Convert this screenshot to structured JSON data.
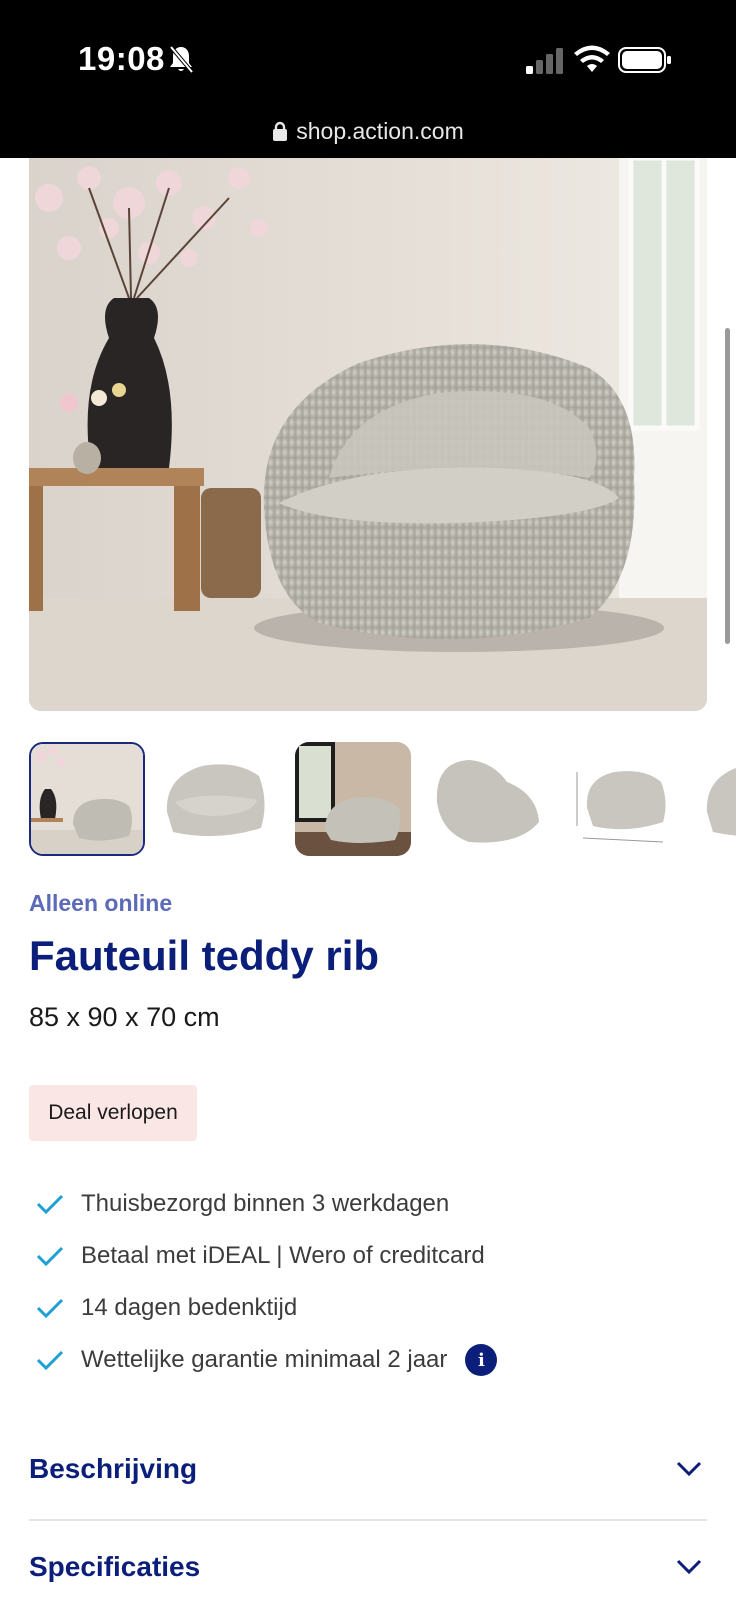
{
  "status_bar": {
    "time": "19:08"
  },
  "browser": {
    "url": "shop.action.com"
  },
  "product": {
    "availability_label": "Alleen online",
    "title": "Fauteuil teddy rib",
    "dimensions": "85 x 90 x 70 cm",
    "deal_badge": "Deal verlopen",
    "usps": [
      "Thuisbezorgd binnen 3 werkdagen",
      "Betaal met iDEAL | Wero of creditcard",
      "14 dagen bedenktijd",
      "Wettelijke garantie minimaal 2 jaar"
    ]
  },
  "accordions": [
    {
      "label": "Beschrijving"
    },
    {
      "label": "Specificaties"
    }
  ],
  "colors": {
    "brand_navy": "#0b1e7a",
    "accent_check": "#1e9fd6",
    "deal_bg": "#fbe6e6"
  }
}
